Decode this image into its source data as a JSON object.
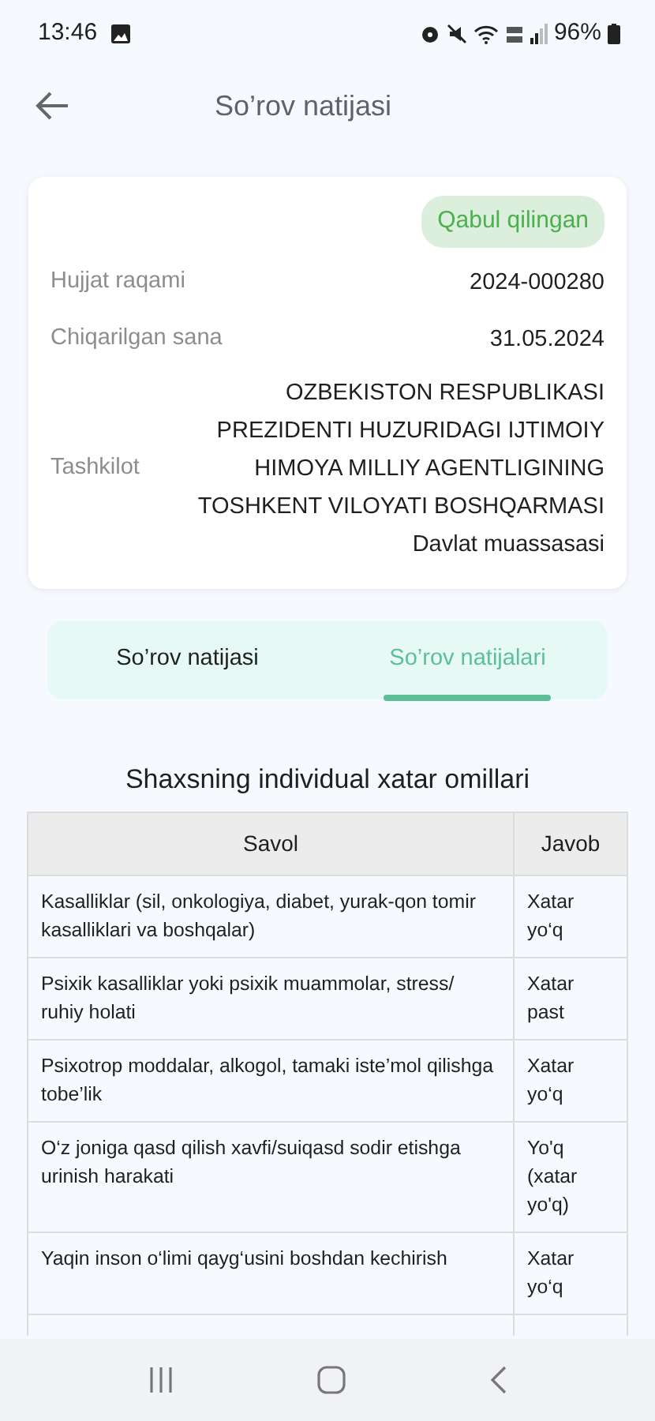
{
  "status_bar": {
    "time": "13:46",
    "battery": "96%"
  },
  "app_bar": {
    "title": "So’rov natijasi"
  },
  "document": {
    "status": "Qabul qilingan",
    "fields": [
      {
        "label": "Hujjat raqami",
        "value": "2024-000280"
      },
      {
        "label": "Chiqarilgan sana",
        "value": "31.05.2024"
      },
      {
        "label": "Tashkilot",
        "value": "OZBEKISTON RESPUBLIKASI PREZIDENTI HUZURIDAGI IJTIMOIY HIMOYA MILLIY AGENTLIGINING TOSHKENT VILOYATI BOSHQARMASI Davlat muassasasi"
      }
    ]
  },
  "tabs": [
    {
      "label": "So’rov natijasi",
      "selected": false
    },
    {
      "label": "So’rov natijalari",
      "selected": true
    }
  ],
  "section_title": "Shaxsning individual xatar omillari",
  "table": {
    "columns": [
      "Savol",
      "Javob"
    ],
    "rows": [
      [
        "Kasalliklar (sil, onkologiya, diabet, yurak-qon tomir kasalliklari va boshqalar)",
        "Xatar yo‘q"
      ],
      [
        "Psixik kasalliklar yoki psixik muammolar, stress/ ruhiy holati",
        "Xatar past"
      ],
      [
        "Psixotrop moddalar, alkogol, tamaki iste’mol qilishga tobe’lik",
        "Xatar yo‘q"
      ],
      [
        "O‘z joniga qasd qilish xavfi/suiqasd sodir etishga urinish harakati",
        "Yo'q (xatar yo'q)"
      ],
      [
        "Yaqin inson o‘limi qayg‘usini boshdan kechirish",
        "Xatar yo‘q"
      ]
    ]
  }
}
